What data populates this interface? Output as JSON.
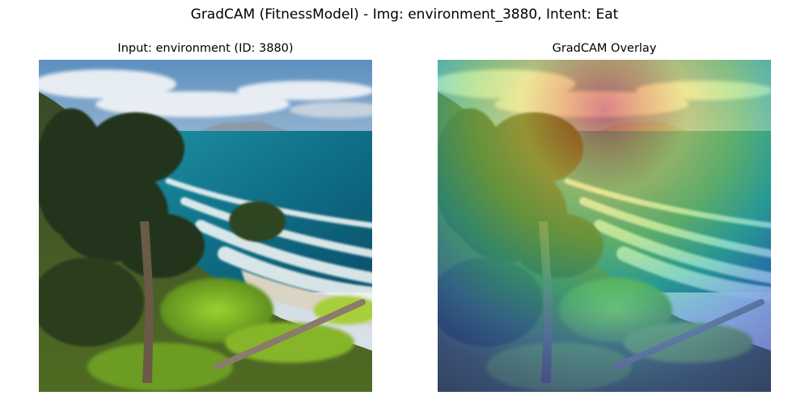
{
  "figure": {
    "title": "GradCAM (FitnessModel) - Img: environment_3880, Intent: Eat"
  },
  "panels": {
    "input": {
      "title": "Input: environment (ID: 3880)"
    },
    "overlay": {
      "title": "GradCAM Overlay"
    }
  },
  "image_content": {
    "scene": "coastal landscape with pine trees, turquoise sea, breaking surf, distant island and cloudy sky",
    "overlay_colormap": "jet",
    "heatmap_hotspot": "upper center (sky and horizon)",
    "heatmap_coldspot": "lower left (trees and grass)"
  }
}
